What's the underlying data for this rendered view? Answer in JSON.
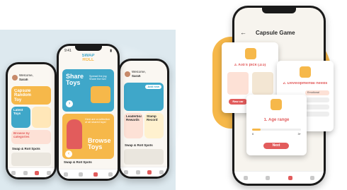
{
  "left_showcase": {
    "phone1": {
      "greeting": "Welcome,",
      "user_name": "Sarah",
      "capsule_title": "Capsule Random Toy",
      "latest_toys": "Latest Toys",
      "browse_categories": "Browse by categories",
      "swap_spots": "Swap & Roll Spots"
    },
    "phone2": {
      "time": "9:41",
      "logo_line1": "SWAP",
      "logo_line2": "ROLL",
      "share_title": "Share Toys",
      "share_desc": "Spread the joy, Share the fun!",
      "browse_desc": "Here are a collection of all shared toys!",
      "browse_title": "Browse Toys",
      "swap_spots": "Swap & Roll Spots"
    },
    "phone3": {
      "greeting": "Welcome,",
      "user_name": "Sarah",
      "add_new": "Add new",
      "leaderboard": "Leaderboard Rewards",
      "stamp_record": "Stamp Record",
      "swap_spots": "Swap & Roll Spots"
    }
  },
  "capsule_screen": {
    "back_glyph": "←",
    "title": "Capsule Game",
    "kids_pick": "3. Kid's pick (1/3)",
    "kids_pick_btn": "Raw car",
    "dev_needs": "2. Developmental needs",
    "dev_option": "Emotional",
    "age_range": "1. Age range",
    "age_min": "0",
    "age_max": "3+",
    "next": "Next"
  },
  "colors": {
    "accent_orange": "#f6b84a",
    "teal": "#3fa7c9",
    "red": "#e25c5c",
    "bg_blue": "#dde9ef"
  }
}
